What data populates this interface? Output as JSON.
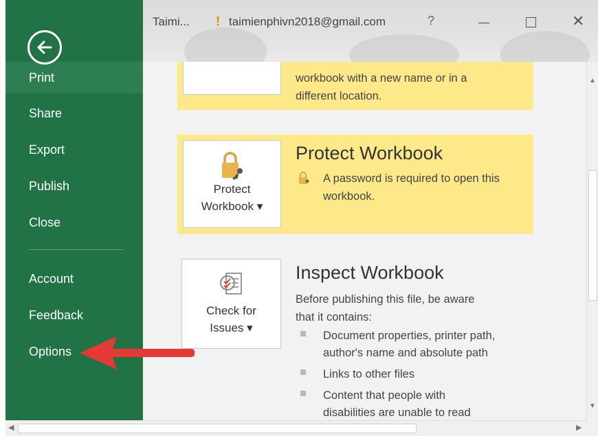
{
  "titlebar": {
    "file_name": "Taimi...",
    "warning_symbol": "!",
    "account_email": "taimienphivn2018@gmail.com",
    "help_symbol": "?",
    "close_symbol": "✕"
  },
  "sidebar": {
    "items": [
      {
        "label": "Print"
      },
      {
        "label": "Share"
      },
      {
        "label": "Export"
      },
      {
        "label": "Publish"
      },
      {
        "label": "Close"
      },
      {
        "label": "Account"
      },
      {
        "label": "Feedback"
      },
      {
        "label": "Options"
      }
    ]
  },
  "save_as_section": {
    "description_line1": "workbook with a new name or in a",
    "description_line2": "different location."
  },
  "protect_section": {
    "tile_line1": "Protect",
    "tile_line2": "Workbook ▾",
    "title": "Protect Workbook",
    "description_line1": "A password is required to open this",
    "description_line2": "workbook."
  },
  "inspect_section": {
    "tile_line1": "Check for",
    "tile_line2": "Issues ▾",
    "title": "Inspect Workbook",
    "intro_line1": "Before publishing this file, be aware",
    "intro_line2": "that it contains:",
    "bullets": [
      {
        "line1": "Document properties, printer path,",
        "line2": "author's name and absolute path"
      },
      {
        "line1": "Links to other files",
        "line2": ""
      },
      {
        "line1": "Content that people with",
        "line2": "disabilities are unable to read"
      }
    ]
  },
  "colors": {
    "sidebar": "#217346",
    "highlight_row": "#fde98a",
    "annotation_arrow": "#e53935"
  },
  "icons": [
    "back-arrow-icon",
    "warning-icon",
    "lock-key-icon",
    "inspect-checklist-icon"
  ]
}
